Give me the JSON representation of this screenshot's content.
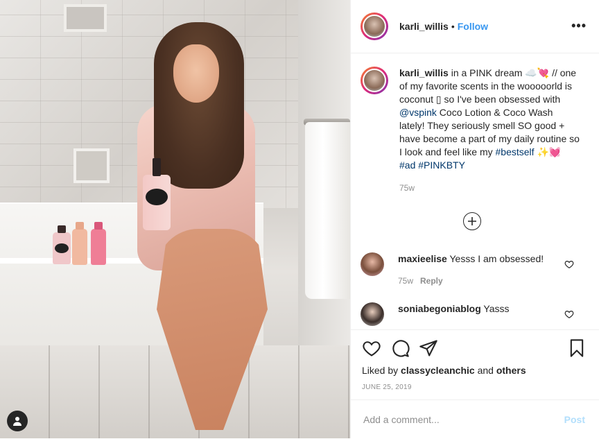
{
  "header": {
    "username": "karli_willis",
    "separator": "•",
    "follow_label": "Follow",
    "more_label": "•••"
  },
  "caption": {
    "username": "karli_willis",
    "text_part1": " in a PINK dream ☁️💘 // one of my favorite scents in the wooooorld is coconut ▯ so I've been obsessed with ",
    "mention": "@vspink",
    "text_part2": " Coco Lotion & Coco Wash lately! They seriously smell SO good + have become a part of my daily routine so I look and feel like my ",
    "hashtag1": "#bestself",
    "emoji": " ✨💓 ",
    "hashtag2": "#ad",
    "hashtag3": "#PINKBTY",
    "time": "75w"
  },
  "comments": [
    {
      "username": "maxieelise",
      "text": " Yesss I am obsessed!",
      "time": "75w",
      "reply_label": "Reply"
    },
    {
      "username": "soniabegoniablog",
      "text": " Yasss"
    }
  ],
  "likes": {
    "prefix": "Liked by ",
    "user": "classycleanchic",
    "mid": " and ",
    "others": "others"
  },
  "date": "JUNE 25, 2019",
  "add_comment": {
    "placeholder": "Add a comment...",
    "post_label": "Post"
  },
  "icons": {
    "heart": "heart-icon",
    "comment": "comment-icon",
    "share": "paper-plane-icon",
    "save": "bookmark-icon",
    "more": "plus-circle-icon",
    "user": "user-icon"
  },
  "colors": {
    "link": "#3897f0",
    "tag": "#00376b",
    "muted": "#8e8e8e",
    "post_disabled": "#b2dffc"
  }
}
